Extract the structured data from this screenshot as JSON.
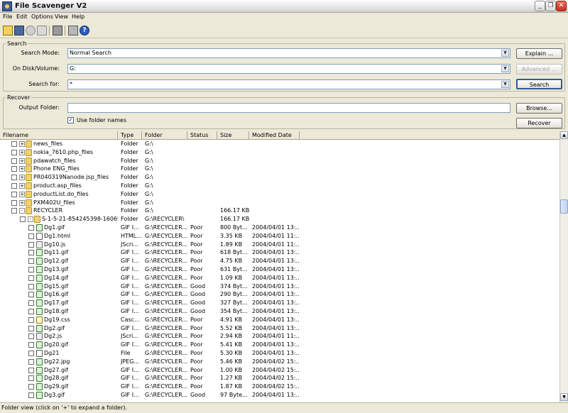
{
  "window": {
    "title": "File Scavenger V2"
  },
  "menu": [
    "File",
    "Edit",
    "Options",
    "View",
    "Help"
  ],
  "toolbar": [
    "search-tool-icon",
    "save-icon",
    "stop-icon",
    "delete-icon",
    "disk-icon",
    "recover-tool-icon",
    "help-icon"
  ],
  "search": {
    "legend": "Search",
    "mode_label": "Search Mode:",
    "mode_value": "Normal Search",
    "disk_label": "On Disk/Volume:",
    "disk_value": "G:",
    "for_label": "Search for:",
    "for_value": "*",
    "explain_label": "Explain ...",
    "advanced_label": "Advanced ...",
    "search_label": "Search"
  },
  "recover": {
    "legend": "Recover",
    "output_label": "Output Folder:",
    "output_value": "",
    "use_folder_names_label": "Use folder names",
    "use_folder_names_checked": true,
    "browse_label": "Browse...",
    "recover_label": "Recover"
  },
  "columns": [
    "Filename",
    "Type",
    "Folder",
    "Status",
    "Size",
    "Modified Date"
  ],
  "rows": [
    {
      "name": "news_files",
      "type": "Folder",
      "folder": "G:\\",
      "status": "",
      "size": "",
      "date": "",
      "level": 0,
      "icon": "folder",
      "expander": "+"
    },
    {
      "name": "nokia_7610.php_files",
      "type": "Folder",
      "folder": "G:\\",
      "status": "",
      "size": "",
      "date": "",
      "level": 0,
      "icon": "folder",
      "expander": "+"
    },
    {
      "name": "pdawatch_files",
      "type": "Folder",
      "folder": "G:\\",
      "status": "",
      "size": "",
      "date": "",
      "level": 0,
      "icon": "folder",
      "expander": "+"
    },
    {
      "name": "Phone ENG_files",
      "type": "Folder",
      "folder": "G:\\",
      "status": "",
      "size": "",
      "date": "",
      "level": 0,
      "icon": "folder",
      "expander": "+"
    },
    {
      "name": "PR040319Nanode.jsp_files",
      "type": "Folder",
      "folder": "G:\\",
      "status": "",
      "size": "",
      "date": "",
      "level": 0,
      "icon": "folder",
      "expander": "+"
    },
    {
      "name": "product.asp_files",
      "type": "Folder",
      "folder": "G:\\",
      "status": "",
      "size": "",
      "date": "",
      "level": 0,
      "icon": "folder",
      "expander": "+"
    },
    {
      "name": "productList.do_files",
      "type": "Folder",
      "folder": "G:\\",
      "status": "",
      "size": "",
      "date": "",
      "level": 0,
      "icon": "folder",
      "expander": "+"
    },
    {
      "name": "PXM402U_files",
      "type": "Folder",
      "folder": "G:\\",
      "status": "",
      "size": "",
      "date": "",
      "level": 0,
      "icon": "folder",
      "expander": "+"
    },
    {
      "name": "RECYCLER",
      "type": "Folder",
      "folder": "G:\\",
      "status": "",
      "size": "166.17 KB",
      "date": "",
      "level": 0,
      "icon": "folder",
      "expander": "-"
    },
    {
      "name": "S-1-5-21-854245398-160698...",
      "type": "Folder",
      "folder": "G:\\RECYCLER\\",
      "status": "",
      "size": "166.17 KB",
      "date": "",
      "level": 1,
      "icon": "folder",
      "expander": "-"
    },
    {
      "name": "Dg1.gif",
      "type": "GIF I...",
      "folder": "G:\\RECYCLER...",
      "status": "Poor",
      "size": "800 Byt...",
      "date": "2004/04/01 13:...",
      "level": 2,
      "icon": "img",
      "expander": ""
    },
    {
      "name": "Dg1.html",
      "type": "HTML...",
      "folder": "G:\\RECYCLER...",
      "status": "Poor",
      "size": "3.35 KB",
      "date": "2004/04/01 11:...",
      "level": 2,
      "icon": "file",
      "expander": ""
    },
    {
      "name": "Dg10.js",
      "type": "JScri...",
      "folder": "G:\\RECYCLER...",
      "status": "Poor",
      "size": "1.89 KB",
      "date": "2004/04/01 11:...",
      "level": 2,
      "icon": "script",
      "expander": ""
    },
    {
      "name": "Dg11.gif",
      "type": "GIF I...",
      "folder": "G:\\RECYCLER...",
      "status": "Poor",
      "size": "618 Byt...",
      "date": "2004/04/01 13:...",
      "level": 2,
      "icon": "img",
      "expander": ""
    },
    {
      "name": "Dg12.gif",
      "type": "GIF I...",
      "folder": "G:\\RECYCLER...",
      "status": "Poor",
      "size": "4.75 KB",
      "date": "2004/04/01 13:...",
      "level": 2,
      "icon": "img",
      "expander": ""
    },
    {
      "name": "Dg13.gif",
      "type": "GIF I...",
      "folder": "G:\\RECYCLER...",
      "status": "Poor",
      "size": "631 Byt...",
      "date": "2004/04/01 13:...",
      "level": 2,
      "icon": "img",
      "expander": ""
    },
    {
      "name": "Dg14.gif",
      "type": "GIF I...",
      "folder": "G:\\RECYCLER...",
      "status": "Poor",
      "size": "1.09 KB",
      "date": "2004/04/01 13:...",
      "level": 2,
      "icon": "img",
      "expander": ""
    },
    {
      "name": "Dg15.gif",
      "type": "GIF I...",
      "folder": "G:\\RECYCLER...",
      "status": "Good",
      "size": "374 Byt...",
      "date": "2004/04/01 13:...",
      "level": 2,
      "icon": "img",
      "expander": ""
    },
    {
      "name": "Dg16.gif",
      "type": "GIF I...",
      "folder": "G:\\RECYCLER...",
      "status": "Good",
      "size": "290 Byt...",
      "date": "2004/04/01 13:...",
      "level": 2,
      "icon": "img",
      "expander": ""
    },
    {
      "name": "Dg17.gif",
      "type": "GIF I...",
      "folder": "G:\\RECYCLER...",
      "status": "Good",
      "size": "327 Byt...",
      "date": "2004/04/01 13:...",
      "level": 2,
      "icon": "img",
      "expander": ""
    },
    {
      "name": "Dg18.gif",
      "type": "GIF I...",
      "folder": "G:\\RECYCLER...",
      "status": "Good",
      "size": "354 Byt...",
      "date": "2004/04/01 13:...",
      "level": 2,
      "icon": "img",
      "expander": ""
    },
    {
      "name": "Dg19.css",
      "type": "Casc...",
      "folder": "G:\\RECYCLER...",
      "status": "Poor",
      "size": "4.91 KB",
      "date": "2004/04/01 13:...",
      "level": 2,
      "icon": "css",
      "expander": ""
    },
    {
      "name": "Dg2.gif",
      "type": "GIF I...",
      "folder": "G:\\RECYCLER...",
      "status": "Poor",
      "size": "5.52 KB",
      "date": "2004/04/01 13:...",
      "level": 2,
      "icon": "img",
      "expander": ""
    },
    {
      "name": "Dg2.js",
      "type": "JScri...",
      "folder": "G:\\RECYCLER...",
      "status": "Poor",
      "size": "2.94 KB",
      "date": "2004/04/01 11:...",
      "level": 2,
      "icon": "script",
      "expander": ""
    },
    {
      "name": "Dg20.gif",
      "type": "GIF I...",
      "folder": "G:\\RECYCLER...",
      "status": "Poor",
      "size": "5.41 KB",
      "date": "2004/04/01 13:...",
      "level": 2,
      "icon": "img",
      "expander": ""
    },
    {
      "name": "Dg21",
      "type": "File",
      "folder": "G:\\RECYCLER...",
      "status": "Poor",
      "size": "5.30 KB",
      "date": "2004/04/01 13:...",
      "level": 2,
      "icon": "file",
      "expander": ""
    },
    {
      "name": "Dg22.jpg",
      "type": "JPEG...",
      "folder": "G:\\RECYCLER...",
      "status": "Poor",
      "size": "5.46 KB",
      "date": "2004/04/02 15:...",
      "level": 2,
      "icon": "img",
      "expander": ""
    },
    {
      "name": "Dg27.gif",
      "type": "GIF I...",
      "folder": "G:\\RECYCLER...",
      "status": "Poor",
      "size": "1.00 KB",
      "date": "2004/04/02 15:...",
      "level": 2,
      "icon": "img",
      "expander": ""
    },
    {
      "name": "Dg28.gif",
      "type": "GIF I...",
      "folder": "G:\\RECYCLER...",
      "status": "Poor",
      "size": "1.27 KB",
      "date": "2004/04/02 15:...",
      "level": 2,
      "icon": "img",
      "expander": ""
    },
    {
      "name": "Dg29.gif",
      "type": "GIF I...",
      "folder": "G:\\RECYCLER...",
      "status": "Poor",
      "size": "1.87 KB",
      "date": "2004/04/02 15:...",
      "level": 2,
      "icon": "img",
      "expander": ""
    },
    {
      "name": "Dg3.gif",
      "type": "GIF I...",
      "folder": "G:\\RECYCLER...",
      "status": "Good",
      "size": "97 Byte...",
      "date": "2004/04/01 13:...",
      "level": 2,
      "icon": "img",
      "expander": ""
    }
  ],
  "statusbar": "Folder view (click on '+' to expand a folder).",
  "colors": {
    "chrome": "#ece9d8",
    "field_border": "#7f9db9",
    "close_button": "#c0341f"
  }
}
